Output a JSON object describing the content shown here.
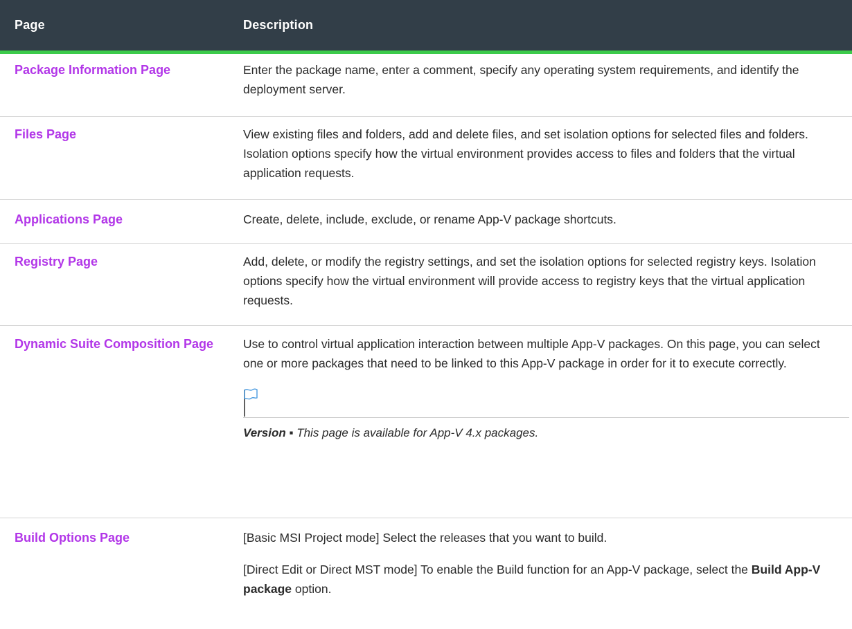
{
  "table": {
    "headers": {
      "page": "Page",
      "description": "Description"
    },
    "rows": [
      {
        "page": "Package Information Page",
        "description": "Enter the package name, enter a comment, specify any operating system requirements, and identify the deployment server."
      },
      {
        "page": "Files Page",
        "description": "View existing files and folders, add and delete files, and set isolation options for selected files and folders. Isolation options specify how the virtual environment provides access to files and folders that the virtual application requests."
      },
      {
        "page": "Applications Page",
        "description": "Create, delete, include, exclude, or rename App-V package shortcuts."
      },
      {
        "page": "Registry Page",
        "description": "Add, delete, or modify the registry settings, and set the isolation options for selected registry keys. Isolation options specify how the virtual environment will provide access to registry keys that the virtual application requests."
      },
      {
        "page": "Dynamic Suite Composition Page",
        "description": "Use to control virtual application interaction between multiple App-V packages. On this page, you can select one or more packages that need to be linked to this App-V package in order for it to execute correctly.",
        "note": {
          "icon": "flag-icon",
          "label": "Version",
          "separator": " ▪ ",
          "text": "This page is available for App-V 4.x packages."
        }
      },
      {
        "page": "Build Options Page",
        "description": "[Basic MSI Project mode] Select the releases that you want to build.",
        "description2_before": "[Direct Edit or Direct MST mode] To enable the Build function for an App-V package, select the ",
        "description2_bold": "Build App-V package",
        "description2_after": " option."
      }
    ]
  },
  "colors": {
    "header_bg": "#323e48",
    "header_accent": "#3ccb4b",
    "link": "#b236e8"
  }
}
